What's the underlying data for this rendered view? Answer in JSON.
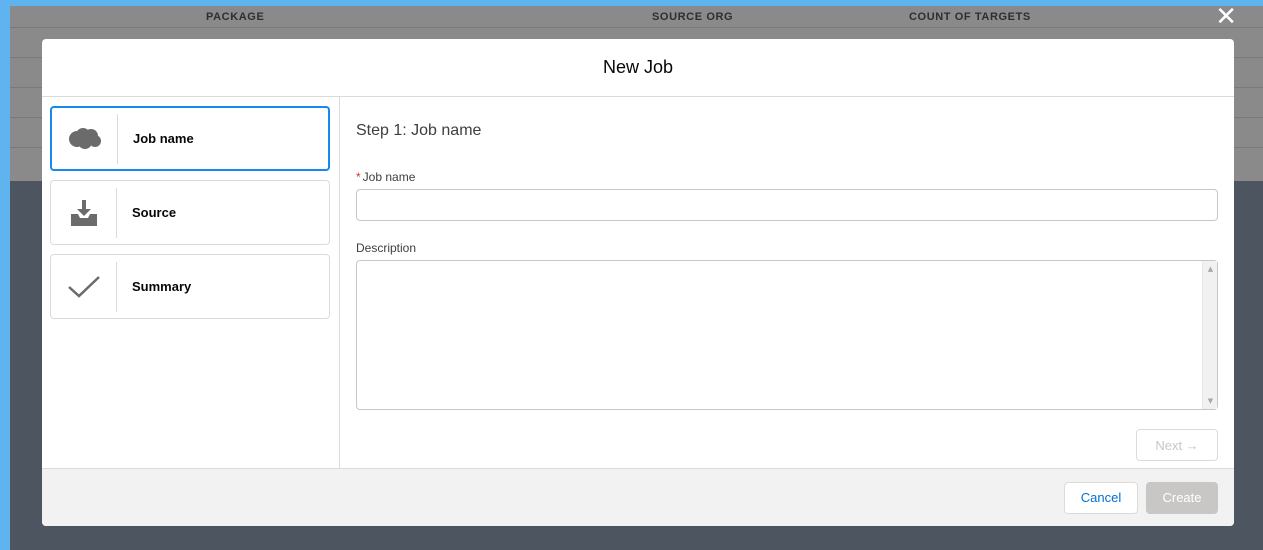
{
  "background_table": {
    "columns": [
      "PACKAGE",
      "SOURCE ORG",
      "COUNT OF TARGETS"
    ]
  },
  "modal": {
    "title": "New Job",
    "steps": [
      {
        "label": "Job name",
        "icon": "salesforce-cloud-icon",
        "active": true
      },
      {
        "label": "Source",
        "icon": "download-icon",
        "active": false
      },
      {
        "label": "Summary",
        "icon": "check-icon",
        "active": false
      }
    ],
    "content": {
      "step_title": "Step 1: Job name",
      "required_marker": "*",
      "job_name_label": "Job name",
      "job_name_value": "",
      "description_label": "Description",
      "description_value": "",
      "next_label": "Next →"
    },
    "footer": {
      "cancel_label": "Cancel",
      "create_label": "Create"
    }
  },
  "close_label": "✕",
  "colors": {
    "accent": "#1589ee",
    "link": "#0070d2",
    "required": "#c23934",
    "disabled": "#c9c7c5",
    "outer_border": "#5fb4ef",
    "overlay": "#4c5560"
  }
}
